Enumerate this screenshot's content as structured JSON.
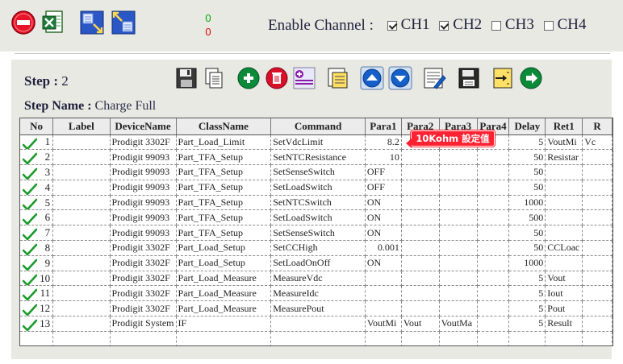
{
  "toolbar": {
    "icons": [
      "stop-icon",
      "excel-export-icon",
      "import-icon",
      "export-icon"
    ],
    "pass_count": "0",
    "fail_count": "0"
  },
  "channels": {
    "label": "Enable Channel :",
    "items": [
      {
        "name": "CH1",
        "checked": true
      },
      {
        "name": "CH2",
        "checked": true
      },
      {
        "name": "CH3",
        "checked": false
      },
      {
        "name": "CH4",
        "checked": false
      }
    ]
  },
  "step": {
    "label": "Step :",
    "value": "2",
    "name_label": "Step Name :",
    "name_value": "Charge Full"
  },
  "step_toolbar": {
    "buttons": [
      "save-icon",
      "copy-icon",
      "add-icon",
      "delete-icon",
      "insert-icon",
      "paste-icon",
      "move-up-icon",
      "move-down-icon",
      "edit-icon",
      "save-as-icon",
      "import-step-icon",
      "next-icon"
    ]
  },
  "callout": "10Kohm 設定值",
  "table": {
    "columns": [
      "No",
      "Label",
      "DeviceName",
      "ClassName",
      "Command",
      "Para1",
      "Para2",
      "Para3",
      "Para4",
      "Delay",
      "Ret1",
      "R"
    ],
    "rows": [
      [
        "1",
        "",
        "Prodigit 3302F",
        "Part_Load_Limit",
        "SetVdcLimit",
        "8.2",
        "",
        "",
        "",
        "5",
        "VoutMi",
        "Vc"
      ],
      [
        "2",
        "",
        "Prodigit 99093",
        "Part_TFA_Setup",
        "SetNTCResistance",
        "10",
        "",
        "",
        "",
        "50",
        "Resistar",
        ""
      ],
      [
        "3",
        "",
        "Prodigit 99093",
        "Part_TFA_Setup",
        "SetSenseSwitch",
        "OFF",
        "",
        "",
        "",
        "50",
        "",
        ""
      ],
      [
        "4",
        "",
        "Prodigit 99093",
        "Part_TFA_Setup",
        "SetLoadSwitch",
        "OFF",
        "",
        "",
        "",
        "50",
        "",
        ""
      ],
      [
        "5",
        "",
        "Prodigit 99093",
        "Part_TFA_Setup",
        "SetNTCSwitch",
        "ON",
        "",
        "",
        "",
        "1000",
        "",
        ""
      ],
      [
        "6",
        "",
        "Prodigit 99093",
        "Part_TFA_Setup",
        "SetLoadSwitch",
        "ON",
        "",
        "",
        "",
        "500",
        "",
        ""
      ],
      [
        "7",
        "",
        "Prodigit 99093",
        "Part_TFA_Setup",
        "SetSenseSwitch",
        "ON",
        "",
        "",
        "",
        "50",
        "",
        ""
      ],
      [
        "8",
        "",
        "Prodigit 3302F",
        "Part_Load_Setup",
        "SetCCHigh",
        "0.001",
        "",
        "",
        "",
        "50",
        "CCLoac",
        ""
      ],
      [
        "9",
        "",
        "Prodigit 3302F",
        "Part_Load_Setup",
        "SetLoadOnOff",
        "ON",
        "",
        "",
        "",
        "1000",
        "",
        ""
      ],
      [
        "10",
        "",
        "Prodigit 3302F",
        "Part_Load_Measure",
        "MeasureVdc",
        "",
        "",
        "",
        "",
        "5",
        "Vout",
        ""
      ],
      [
        "11",
        "",
        "Prodigit 3302F",
        "Part_Load_Measure",
        "MeasureIdc",
        "",
        "",
        "",
        "",
        "5",
        "Iout",
        ""
      ],
      [
        "12",
        "",
        "Prodigit 3302F",
        "Part_Load_Measure",
        "MeasurePout",
        "",
        "",
        "",
        "",
        "5",
        "Pout",
        ""
      ],
      [
        "13",
        "",
        "Prodigit System",
        "IF",
        "",
        "VoutMi",
        "Vout",
        "VoutMa",
        "",
        "5",
        "Result",
        ""
      ],
      [
        "",
        "",
        "",
        "",
        "",
        "",
        "",
        "",
        "",
        "",
        "",
        ""
      ]
    ]
  },
  "colors": {
    "panel_bg": "#e9e9e4",
    "pass_green": "#00a800",
    "fail_red": "#e00000",
    "callout_red": "#ff2233"
  }
}
